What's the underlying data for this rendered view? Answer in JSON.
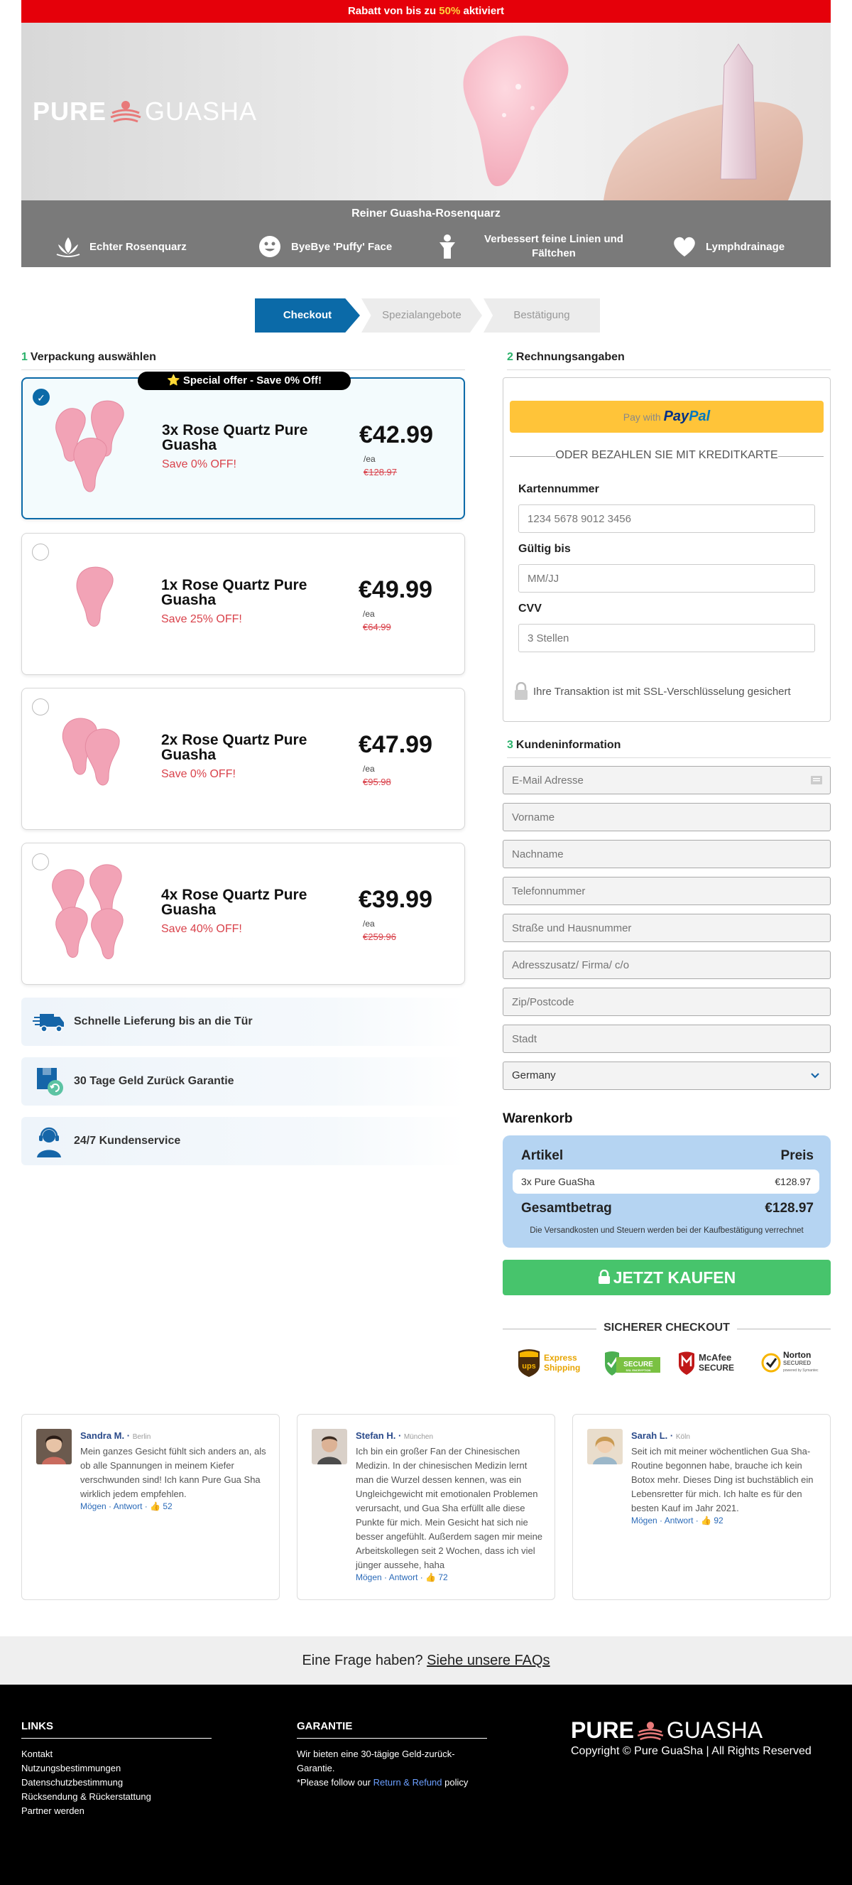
{
  "topbar": {
    "prefix": "Rabatt von bis zu ",
    "percent": "50%",
    "suffix": " aktiviert"
  },
  "logo": {
    "pure": "PURE",
    "guasha": "GUASHA"
  },
  "features": {
    "title": "Reiner Guasha-Rosenquarz",
    "items": [
      {
        "label": "Echter Rosenquarz",
        "icon": "lotus-icon"
      },
      {
        "label": "ByeBye 'Puffy' Face",
        "icon": "smiley-icon"
      },
      {
        "label": "Verbessert feine Linien und Fältchen",
        "icon": "person-icon"
      },
      {
        "label": "Lymphdrainage",
        "icon": "heart-icon"
      }
    ]
  },
  "steps": [
    "Checkout",
    "Spezialangebote",
    "Bestätigung"
  ],
  "packaging": {
    "num": "1",
    "title": "Verpackung auswählen",
    "offer": "Special offer - Save 0% Off!",
    "items": [
      {
        "name": "3x Rose Quartz Pure Guasha",
        "save": "Save 0% OFF!",
        "price": "€42.99",
        "ea": "/ea",
        "old": "€128.97",
        "selected": true
      },
      {
        "name": "1x Rose Quartz Pure Guasha",
        "save": "Save 25% OFF!",
        "price": "€49.99",
        "ea": "/ea",
        "old": "€64.99",
        "selected": false
      },
      {
        "name": "2x Rose Quartz Pure Guasha",
        "save": "Save 0% OFF!",
        "price": "€47.99",
        "ea": "/ea",
        "old": "€95.98",
        "selected": false
      },
      {
        "name": "4x Rose Quartz Pure Guasha",
        "save": "Save 40% OFF!",
        "price": "€39.99",
        "ea": "/ea",
        "old": "€259.96",
        "selected": false
      }
    ]
  },
  "perks": [
    "Schnelle Lieferung bis an die Tür",
    "30 Tage Geld Zurück Garantie",
    "24/7 Kundenservice"
  ],
  "billing": {
    "num": "2",
    "title": "Rechnungsangaben",
    "paypal_prefix": "Pay with",
    "paypal_pay": "Pay",
    "paypal_pal": "Pal",
    "or_card": "ODER BEZAHLEN SIE MIT KREDITKARTE",
    "card_label": "Kartennummer",
    "card_placeholder": "1234 5678 9012 3456",
    "exp_label": "Gültig bis",
    "exp_placeholder": "MM/JJ",
    "cvv_label": "CVV",
    "cvv_placeholder": "3 Stellen",
    "ssl": "Ihre Transaktion ist mit SSL-Verschlüsselung gesichert"
  },
  "customer": {
    "num": "3",
    "title": "Kundeninformation",
    "fields": [
      "E-Mail Adresse",
      "Vorname",
      "Nachname",
      "Telefonnummer",
      "Straße und Hausnummer",
      "Adresszusatz/ Firma/ c/o",
      "Zip/Postcode",
      "Stadt"
    ],
    "country": "Germany"
  },
  "cart": {
    "title": "Warenkorb",
    "col_item": "Artikel",
    "col_price": "Preis",
    "item": "3x Pure GuaSha",
    "item_price": "€128.97",
    "total_label": "Gesamtbetrag",
    "total": "€128.97",
    "note": "Die Versandkosten und Steuern werden bei der Kaufbestätigung verrechnet"
  },
  "buy_button": "JETZT KAUFEN",
  "secure_checkout": "SICHERER CHECKOUT",
  "badges": {
    "ups_top": "Express",
    "ups_bottom": "Shipping",
    "ups_logo": "ups",
    "secure": "SECURE",
    "secure_sub": "SSL ENCRYPTION",
    "mcafee_top": "McAfee",
    "mcafee_bottom": "SECURE",
    "norton_top": "Norton",
    "norton_bottom": "SECURED",
    "norton_sub": "powered by Symantec"
  },
  "reviews": [
    {
      "name": "Sandra M.",
      "city": "Berlin",
      "text": "Mein ganzes Gesicht fühlt sich anders an, als ob alle Spannungen in meinem Kiefer verschwunden sind! Ich kann Pure Gua Sha wirklich jedem empfehlen.",
      "like": "Mögen",
      "reply": "Antwort",
      "count": "52"
    },
    {
      "name": "Stefan H.",
      "city": "München",
      "text": "Ich bin ein großer Fan der Chinesischen Medizin. In der chinesischen Medizin lernt man die Wurzel dessen kennen, was ein Ungleichgewicht mit emotionalen Problemen verursacht, und Gua Sha erfüllt alle diese Punkte für mich. Mein Gesicht hat sich nie besser angefühlt. Außerdem sagen mir meine Arbeitskollegen seit 2 Wochen, dass ich viel jünger aussehe, haha",
      "like": "Mögen",
      "reply": "Antwort",
      "count": "72"
    },
    {
      "name": "Sarah L.",
      "city": "Köln",
      "text": "Seit ich mit meiner wöchentlichen Gua Sha-Routine begonnen habe, brauche ich kein Botox mehr. Dieses Ding ist buchstäblich ein Lebensretter für mich. Ich halte es für den besten Kauf im Jahr 2021.",
      "like": "Mögen",
      "reply": "Antwort",
      "count": "92"
    }
  ],
  "faq": {
    "text": "Eine Frage haben? ",
    "link": "Siehe unsere FAQs"
  },
  "footer": {
    "links_title": "LINKS",
    "links": [
      "Kontakt",
      "Nutzungsbestimmungen",
      "Datenschutzbestimmung",
      "Rücksendung & Rückerstattung",
      "Partner werden"
    ],
    "guarantee_title": "GARANTIE",
    "guarantee_text": "Wir bieten eine 30-tägige Geld-zurück-Garantie.",
    "guarantee_follow": "*Please follow our ",
    "guarantee_link": "Return & Refund",
    "guarantee_policy": " policy",
    "copyright": "Copyright © Pure GuaSha | All Rights Reserved"
  },
  "colors": {
    "primary": "#0b6aa8",
    "red": "#e5000a",
    "green": "#47c46c",
    "cart": "#b5d4f2",
    "accent_num": "#2bb26b"
  }
}
